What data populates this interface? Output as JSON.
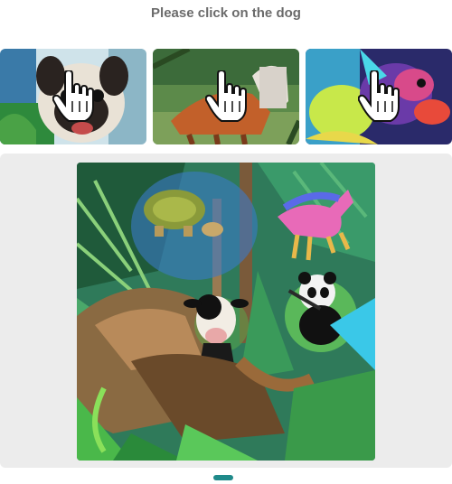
{
  "prompt": {
    "text": "Please click on the dog"
  },
  "tiles": [
    {
      "name": "choice-tile-1",
      "icon": "pointer-hand-icon"
    },
    {
      "name": "choice-tile-2",
      "icon": "pointer-hand-icon"
    },
    {
      "name": "choice-tile-3",
      "icon": "pointer-hand-icon"
    }
  ],
  "scene": {
    "description_icon": "jungle-animal-scene"
  },
  "colors": {
    "stage_background": "#ececec",
    "title_text": "#6b6b6b",
    "accent": "#1f8a8a"
  }
}
